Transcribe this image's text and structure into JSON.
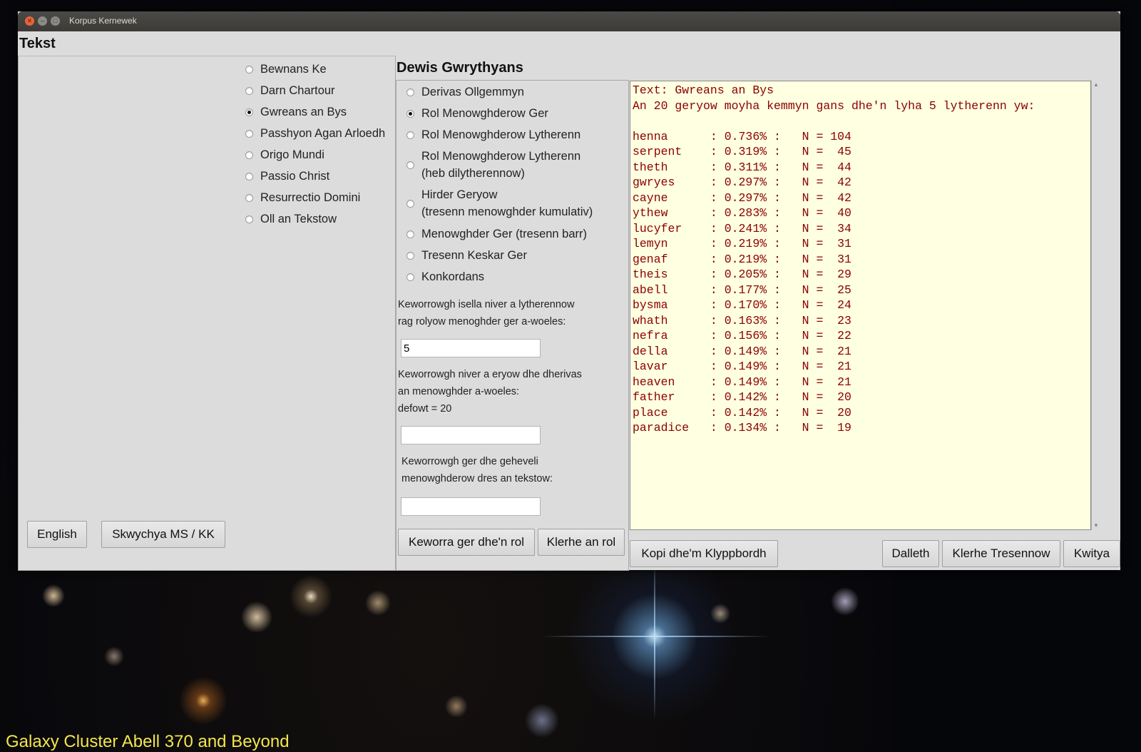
{
  "wallpaper": {
    "caption": "Galaxy Cluster Abell 370 and Beyond",
    "caption_color": "#f3e64a"
  },
  "window": {
    "title": "Korpus Kernewek",
    "titlebar_buttons": [
      "close-icon",
      "minimize-icon",
      "maximize-icon"
    ]
  },
  "tekst": {
    "heading": "Tekst",
    "texts": [
      {
        "label": "Bewnans Ke",
        "selected": false
      },
      {
        "label": "Darn Chartour",
        "selected": false
      },
      {
        "label": "Gwreans an Bys",
        "selected": true
      },
      {
        "label": "Passhyon Agan Arloedh",
        "selected": false
      },
      {
        "label": "Origo Mundi",
        "selected": false
      },
      {
        "label": "Passio Christ",
        "selected": false
      },
      {
        "label": "Resurrectio Domini",
        "selected": false
      },
      {
        "label": "Oll an Tekstow",
        "selected": false
      }
    ],
    "english_button": "English",
    "switch_button": "Skwychya MS / KK"
  },
  "options": {
    "heading": "Dewis Gwrythyans",
    "items": [
      {
        "label": "Derivas Ollgemmyn",
        "label2": "",
        "selected": false
      },
      {
        "label": "Rol Menowghderow Ger",
        "label2": "",
        "selected": true
      },
      {
        "label": "Rol Menowghderow Lytherenn",
        "label2": "",
        "selected": false
      },
      {
        "label": "Rol Menowghderow Lytherenn",
        "label2": "(heb dilytherennow)",
        "selected": false
      },
      {
        "label": "Hirder Geryow",
        "label2": "(tresenn menowghder kumulativ)",
        "selected": false
      },
      {
        "label": "Menowghder Ger (tresenn barr)",
        "label2": "",
        "selected": false
      },
      {
        "label": "Tresenn Keskar Ger",
        "label2": "",
        "selected": false
      },
      {
        "label": "Konkordans",
        "label2": "",
        "selected": false
      }
    ],
    "min_letters_prompt_1": "Keworrowgh isella niver a lytherennow",
    "min_letters_prompt_2": "rag rolyow menoghder ger a-woeles:",
    "min_letters_value": "5",
    "num_words_prompt_1": "Keworrowgh niver a eryow dhe dherivas",
    "num_words_prompt_2": "an menowghder a-woeles:",
    "num_words_prompt_3": "defowt = 20",
    "num_words_value": "",
    "compare_prompt_1": "Keworrowgh ger dhe geheveli",
    "compare_prompt_2": "menowghderow dres an tekstow:",
    "compare_value": "",
    "add_word_button": "Keworra ger dhe'n rol",
    "clear_list_button": "Klerhe an rol"
  },
  "output": {
    "text": "Text: Gwreans an Bys\nAn 20 geryow moyha kemmyn gans dhe'n lyha 5 lytherenn yw:\n\nhenna      : 0.736% :   N = 104\nserpent    : 0.319% :   N =  45\ntheth      : 0.311% :   N =  44\ngwryes     : 0.297% :   N =  42\ncayne      : 0.297% :   N =  42\nythew      : 0.283% :   N =  40\nlucyfer    : 0.241% :   N =  34\nlemyn      : 0.219% :   N =  31\ngenaf      : 0.219% :   N =  31\ntheis      : 0.205% :   N =  29\nabell      : 0.177% :   N =  25\nbysma      : 0.170% :   N =  24\nwhath      : 0.163% :   N =  23\nnefra      : 0.156% :   N =  22\ndella      : 0.149% :   N =  21\nlavar      : 0.149% :   N =  21\nheaven     : 0.149% :   N =  21\nfather     : 0.142% :   N =  20\nplace      : 0.142% :   N =  20\nparadice   : 0.134% :   N =  19",
    "text_color": "#8b0000",
    "background_color": "#ffffe1",
    "copy_button": "Kopi dhe'm Klyppbordh",
    "start_button": "Dalleth",
    "clear_plots_button": "Klerhe Tresennow",
    "quit_button": "Kwitya"
  }
}
